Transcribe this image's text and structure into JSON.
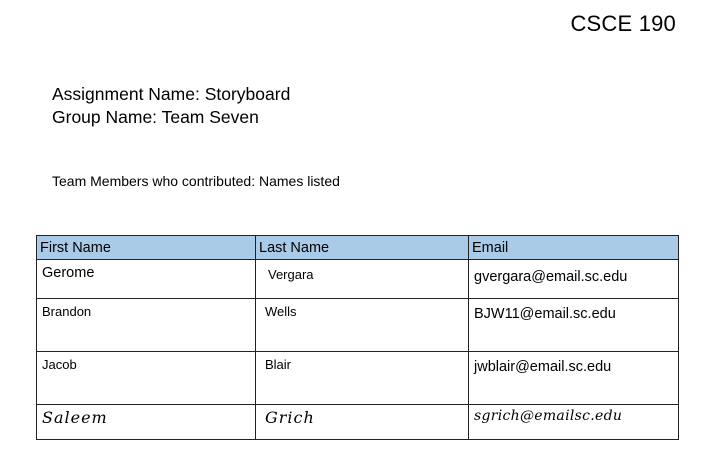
{
  "header": {
    "course": "CSCE 190"
  },
  "info": {
    "assignment": "Assignment Name: Storyboard",
    "group": "Group Name: Team Seven",
    "contributors": "Team Members who contributed: Names listed"
  },
  "table": {
    "headers": [
      "First Name",
      "Last Name",
      "Email"
    ],
    "rows": [
      {
        "first": "Gerome",
        "last": "Vergara",
        "email": "gvergara@email.sc.edu"
      },
      {
        "first": "Brandon",
        "last": "Wells",
        "email": "BJW11@email.sc.edu"
      },
      {
        "first": "Jacob",
        "last": "Blair",
        "email": "jwblair@email.sc.edu"
      },
      {
        "first": "Saleem",
        "last": "Grich",
        "email": "sgrich@emailsc.edu"
      }
    ]
  }
}
